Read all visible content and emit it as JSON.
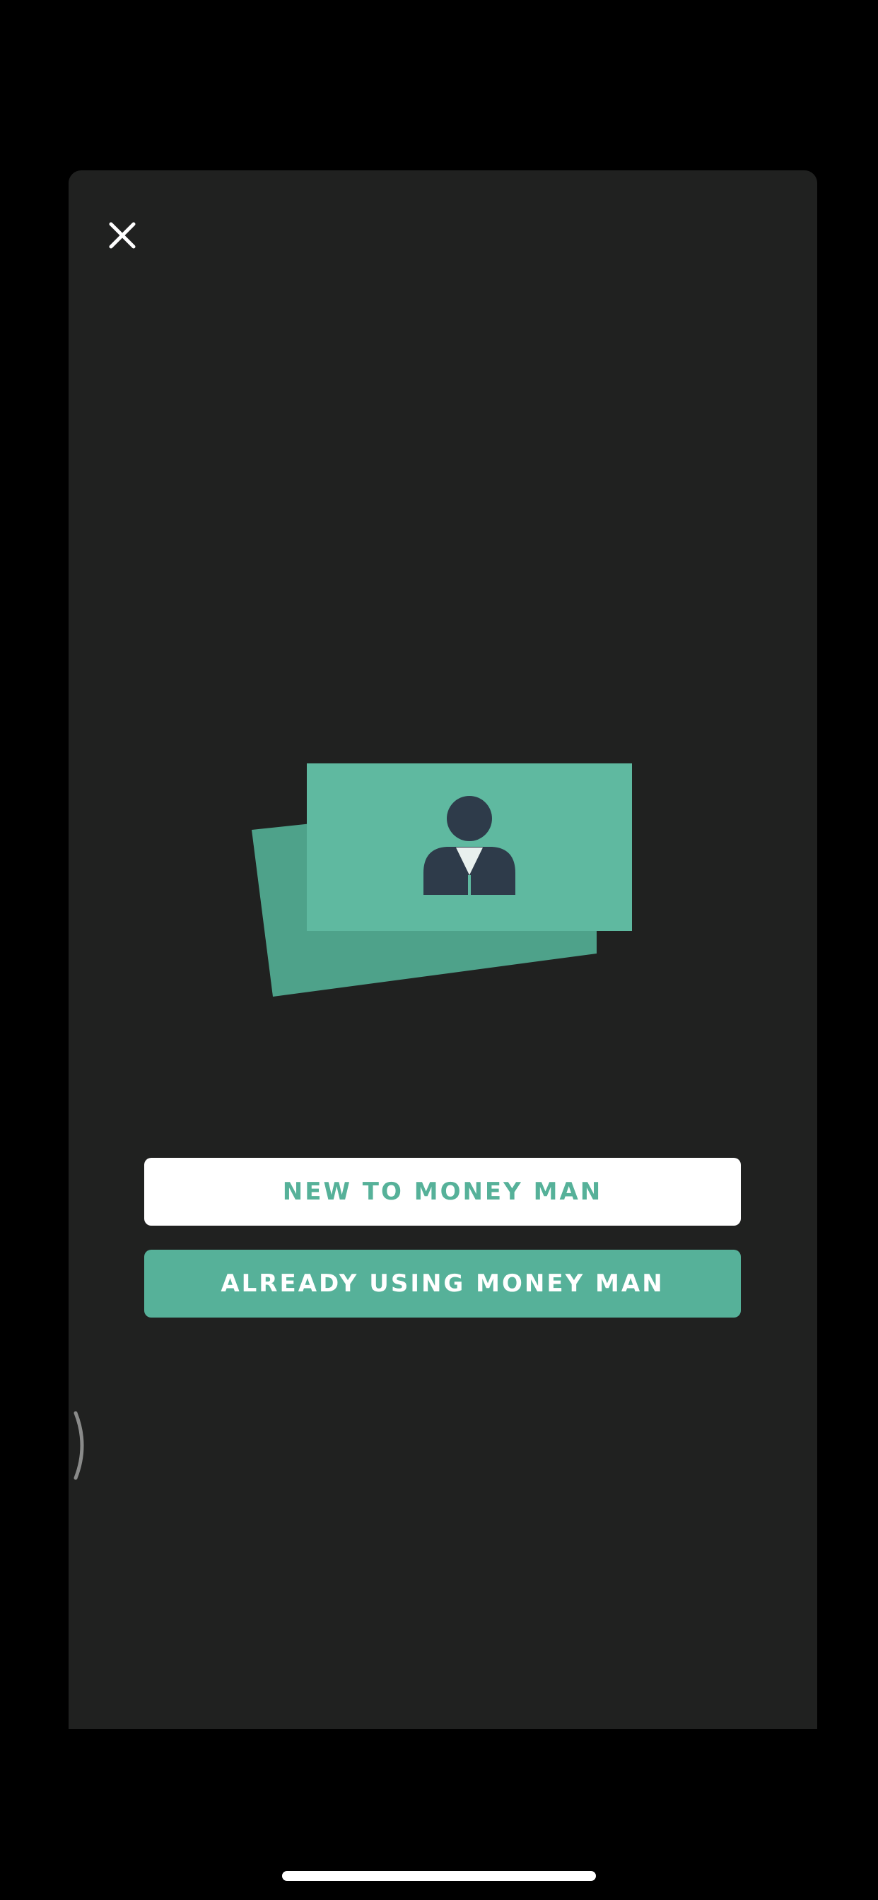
{
  "header": {
    "close_icon": "close-icon"
  },
  "illustration": {
    "icon": "business-card-person-icon",
    "colors": {
      "card_front": "#5fb9a0",
      "card_back": "#4ea28a",
      "person": "#2e3b4a",
      "tie": "#e8f0ee"
    }
  },
  "actions": {
    "new_label": "NEW TO MONEY MAN",
    "existing_label": "ALREADY USING MONEY MAN"
  },
  "colors": {
    "background": "#000000",
    "panel": "#202120",
    "accent": "#56b199",
    "button_light": "#ffffff"
  },
  "system": {
    "home_indicator": "home-indicator"
  }
}
